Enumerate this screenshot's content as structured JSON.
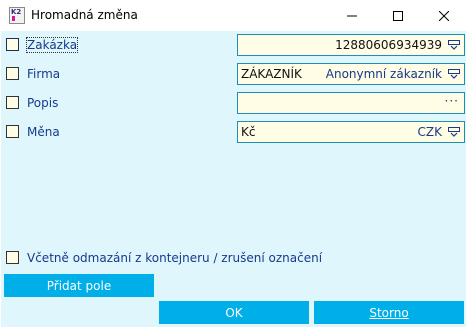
{
  "window": {
    "title": "Hromadná změna",
    "icon": "k2-app-icon",
    "icon_text": "K2"
  },
  "rows": [
    {
      "label": "Zakázka",
      "checked": false,
      "value_left": "",
      "value_right": "12880606934939",
      "control": "dropdown"
    },
    {
      "label": "Firma",
      "checked": false,
      "value_left": "ZÁKAZNÍK",
      "value_right": "Anonymní zákazník",
      "control": "dropdown"
    },
    {
      "label": "Popis",
      "checked": false,
      "value_left": "",
      "value_right": "",
      "control": "ellipsis",
      "ellipsis": "···"
    },
    {
      "label": "Měna",
      "checked": false,
      "value_left": "Kč",
      "value_right": "CZK",
      "control": "dropdown"
    }
  ],
  "options": {
    "include_unmark_label": "Včetně odmazání z kontejneru / zrušení označení",
    "include_unmark_checked": false
  },
  "buttons": {
    "add_field": "Přidat pole",
    "ok": "OK",
    "cancel": "Storno"
  },
  "colors": {
    "accent": "#00aee8",
    "background": "#dff6fd",
    "field": "#fffde6",
    "label": "#173a8c"
  }
}
